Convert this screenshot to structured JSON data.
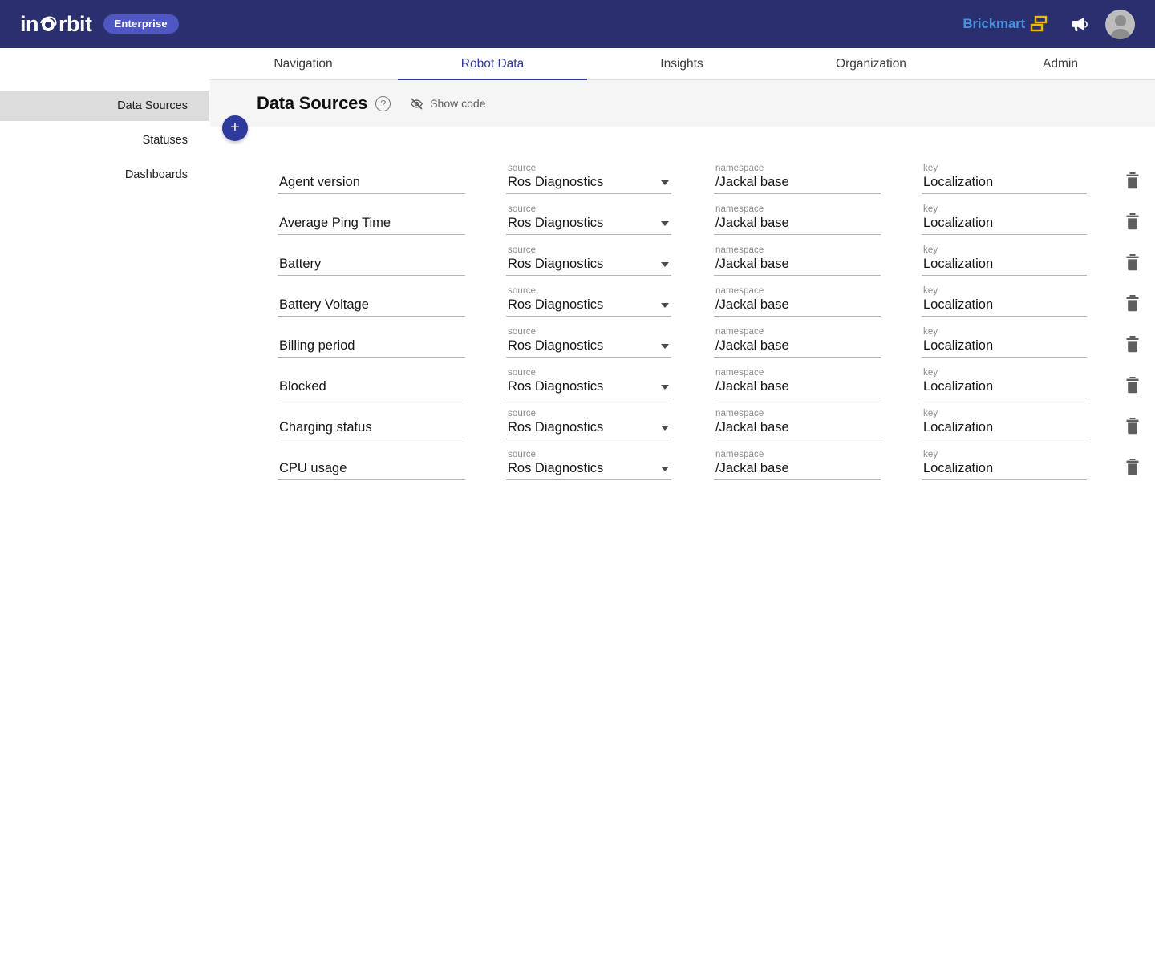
{
  "topbar": {
    "logo_text_left": "in",
    "logo_text_right": "rbit",
    "logo_icon": "orbit-icon",
    "edition_badge": "Enterprise",
    "org_name": "Brickmart",
    "org_logo_icon": "brickmart-blocks-icon",
    "announce_icon": "megaphone-icon",
    "avatar_icon": "user-avatar-icon",
    "background": "#2a2f6e",
    "badge_background": "#4f57c4",
    "org_name_color": "#4b91e2",
    "org_logo_color": "#f2b705"
  },
  "tabs": [
    {
      "label": "Navigation",
      "active": false
    },
    {
      "label": "Robot Data",
      "active": true
    },
    {
      "label": "Insights",
      "active": false
    },
    {
      "label": "Organization",
      "active": false
    },
    {
      "label": "Admin",
      "active": false
    }
  ],
  "tab_accent_color": "#2f3b9c",
  "sidebar": {
    "items": [
      {
        "label": "Data Sources",
        "active": true
      },
      {
        "label": "Statuses",
        "active": false
      },
      {
        "label": "Dashboards",
        "active": false
      }
    ],
    "active_background": "#dcdcdc"
  },
  "page": {
    "title": "Data Sources",
    "help_icon": "question-mark-circle-icon",
    "show_code_label": "Show code",
    "show_code_icon": "eye-off-icon",
    "header_background": "#f5f5f5",
    "add_button_label": "+",
    "add_button_icon": "plus-icon",
    "add_button_color": "#2f3b9c"
  },
  "field_labels": {
    "name": "",
    "source": "source",
    "namespace": "namespace",
    "key": "key"
  },
  "row_icons": {
    "delete": "trash-icon",
    "dropdown": "chevron-down-icon"
  },
  "rows": [
    {
      "name": "Agent version",
      "source": "Ros Diagnostics",
      "namespace": "/Jackal base",
      "key": "Localization"
    },
    {
      "name": "Average Ping Time",
      "source": "Ros Diagnostics",
      "namespace": "/Jackal base",
      "key": "Localization"
    },
    {
      "name": "Battery",
      "source": "Ros Diagnostics",
      "namespace": "/Jackal base",
      "key": "Localization"
    },
    {
      "name": "Battery Voltage",
      "source": "Ros Diagnostics",
      "namespace": "/Jackal base",
      "key": "Localization"
    },
    {
      "name": "Billing period",
      "source": "Ros Diagnostics",
      "namespace": "/Jackal base",
      "key": "Localization"
    },
    {
      "name": "Blocked",
      "source": "Ros Diagnostics",
      "namespace": "/Jackal base",
      "key": "Localization"
    },
    {
      "name": "Charging status",
      "source": "Ros Diagnostics",
      "namespace": "/Jackal base",
      "key": "Localization"
    },
    {
      "name": "CPU usage",
      "source": "Ros Diagnostics",
      "namespace": "/Jackal base",
      "key": "Localization"
    }
  ]
}
